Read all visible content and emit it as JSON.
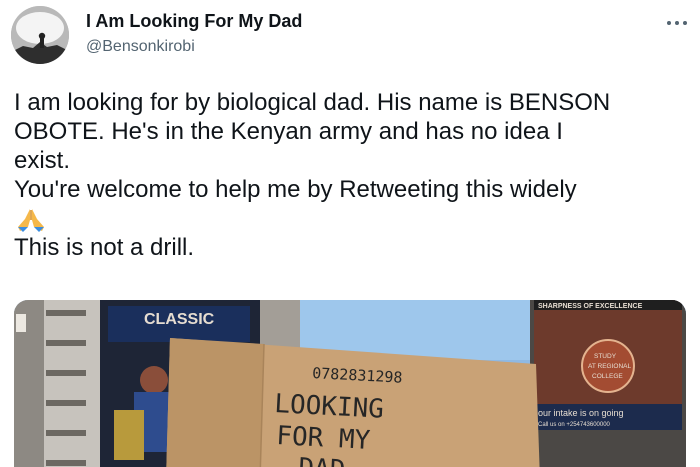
{
  "author": {
    "display_name": "I Am Looking For My Dad",
    "handle": "@Bensonkirobi"
  },
  "more_icon": "more-horizontal-icon",
  "tweet": {
    "lines": [
      "I am looking for by biological dad. His name is BENSON",
      "OBOTE. He's in the Kenyan army and has no idea I",
      "exist.",
      "You're welcome to help me by Retweeting this widely"
    ],
    "emoji": "folded-hands-icon",
    "last_line": "This is not a drill."
  },
  "media": {
    "sign_phone": "0782831298",
    "sign_line1": "LOOKING",
    "sign_line2": "FOR MY",
    "sign_line3": "DAD",
    "billboard_left_title": "CLASSIC",
    "billboard_right_banner": "SHARPNESS OF EXCELLENCE",
    "billboard_right_badge_1": "STUDY",
    "billboard_right_badge_2": "AT REGIONAL",
    "billboard_right_badge_3": "COLLEGE",
    "billboard_right_intake": "our intake is on going",
    "billboard_right_call": "Call us on +254743600000"
  }
}
